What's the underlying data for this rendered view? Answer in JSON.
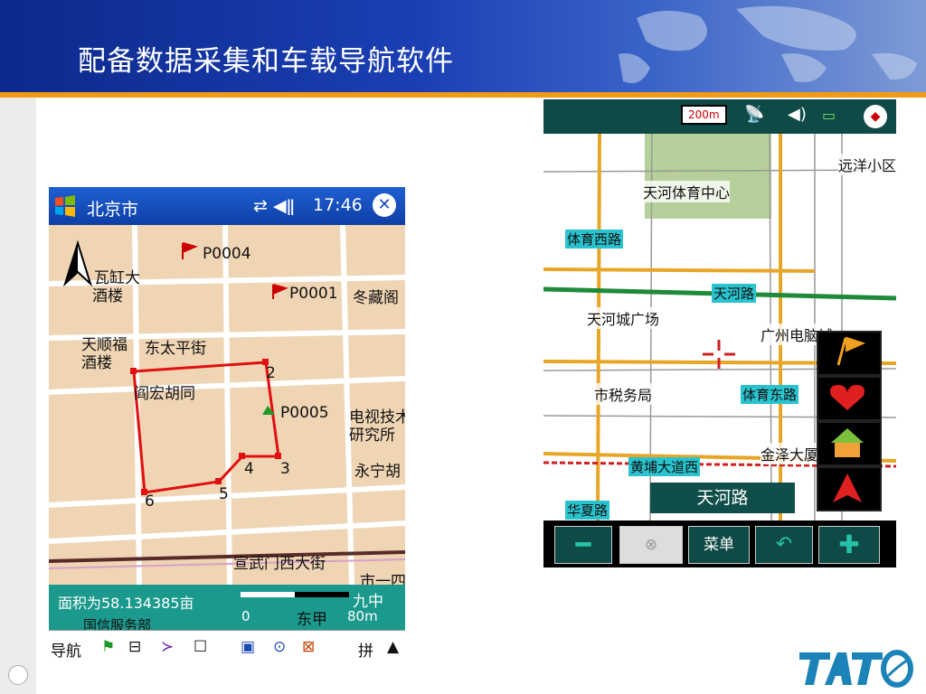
{
  "slide": {
    "title": "配备数据采集和车载导航软件"
  },
  "pda": {
    "title": "北京市",
    "time": "17:46",
    "close_label": "✕",
    "area_text": "面积为58.134385亩",
    "scale_zero": "0",
    "scale_value": "80m",
    "map_labels": {
      "p0004": "P0004",
      "p0001": "P0001",
      "p0005": "P0005",
      "wahongda": "瓦缸大",
      "jiulou1": "酒楼",
      "tianshunfu": "天顺福",
      "jiulou2": "酒楼",
      "dongtaiping": "东太平街",
      "hutong": "阎宏胡同",
      "tv1": "电视技术",
      "tv2": "研究所",
      "yongning": "永宁胡",
      "xuanwu": "宣武门西大街",
      "shiyi": "市一四",
      "jiuzhong": "九中",
      "dongjia": "东甲",
      "guoxin": "国信服务部",
      "dongcheng": "冬藏阁",
      "n2": "2",
      "n3": "3",
      "n4": "4",
      "n5": "5",
      "n6": "6"
    },
    "toolbar": {
      "nav_label": "导航",
      "pin_label": "拼"
    }
  },
  "nav": {
    "scale_label": "200m",
    "current_road": "天河路",
    "menu_label": "菜单",
    "map_labels": {
      "tiyuzhongxin": "天河体育中心",
      "yuanyang": "远洋小区",
      "tiyuxilu": "体育西路",
      "tianhelu": "天河路",
      "tianhecheng": "天河城广场",
      "guangzhou": "广州电脑城",
      "shishuiwuju": "市税务局",
      "tiyudonglu": "体育东路",
      "jinze": "金泽大厦",
      "huangpu": "黄埔大道西",
      "huaxialu": "华夏路"
    }
  },
  "colors": {
    "header_blue": "#0c2a8c",
    "accent_orange": "#f29a16",
    "pda_teal": "#1a998c",
    "nav_dark": "#0f4a46"
  }
}
